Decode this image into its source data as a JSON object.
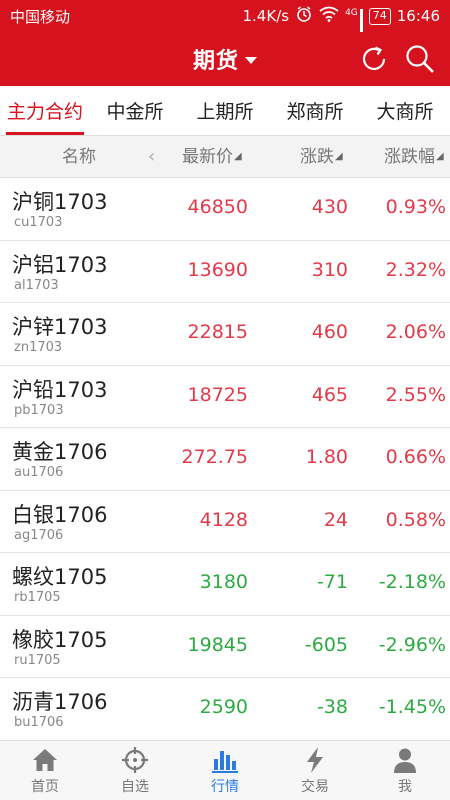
{
  "status": {
    "carrier": "中国移动",
    "speed": "1.4K/s",
    "network": "4G",
    "battery": "74",
    "time": "16:46"
  },
  "nav": {
    "title": "期货",
    "icons": [
      "refresh-icon",
      "search-icon"
    ]
  },
  "tabs": [
    "主力合约",
    "中金所",
    "上期所",
    "郑商所",
    "大商所"
  ],
  "active_tab": "主力合约",
  "columns": {
    "name": "名称",
    "price": "最新价",
    "change": "涨跌",
    "pct": "涨跌幅"
  },
  "rows": [
    {
      "name": "沪铜1703",
      "code": "cu1703",
      "price": "46850",
      "change": "430",
      "pct": "0.93%",
      "dir": "up"
    },
    {
      "name": "沪铝1703",
      "code": "al1703",
      "price": "13690",
      "change": "310",
      "pct": "2.32%",
      "dir": "up"
    },
    {
      "name": "沪锌1703",
      "code": "zn1703",
      "price": "22815",
      "change": "460",
      "pct": "2.06%",
      "dir": "up"
    },
    {
      "name": "沪铅1703",
      "code": "pb1703",
      "price": "18725",
      "change": "465",
      "pct": "2.55%",
      "dir": "up"
    },
    {
      "name": "黄金1706",
      "code": "au1706",
      "price": "272.75",
      "change": "1.80",
      "pct": "0.66%",
      "dir": "up"
    },
    {
      "name": "白银1706",
      "code": "ag1706",
      "price": "4128",
      "change": "24",
      "pct": "0.58%",
      "dir": "up"
    },
    {
      "name": "螺纹1705",
      "code": "rb1705",
      "price": "3180",
      "change": "-71",
      "pct": "-2.18%",
      "dir": "down"
    },
    {
      "name": "橡胶1705",
      "code": "ru1705",
      "price": "19845",
      "change": "-605",
      "pct": "-2.96%",
      "dir": "down"
    },
    {
      "name": "沥青1706",
      "code": "bu1706",
      "price": "2590",
      "change": "-38",
      "pct": "-1.45%",
      "dir": "down"
    }
  ],
  "tabbar": [
    {
      "label": "首页",
      "icon": "home-icon"
    },
    {
      "label": "自选",
      "icon": "crosshair-icon"
    },
    {
      "label": "行情",
      "icon": "bar-chart-icon"
    },
    {
      "label": "交易",
      "icon": "lightning-icon"
    },
    {
      "label": "我",
      "icon": "user-icon"
    }
  ],
  "active_tabbar": "行情",
  "colors": {
    "brand": "#d6121e",
    "up": "#e33a4a",
    "down": "#2eaa43",
    "tab_active": "#2a7ddb"
  }
}
